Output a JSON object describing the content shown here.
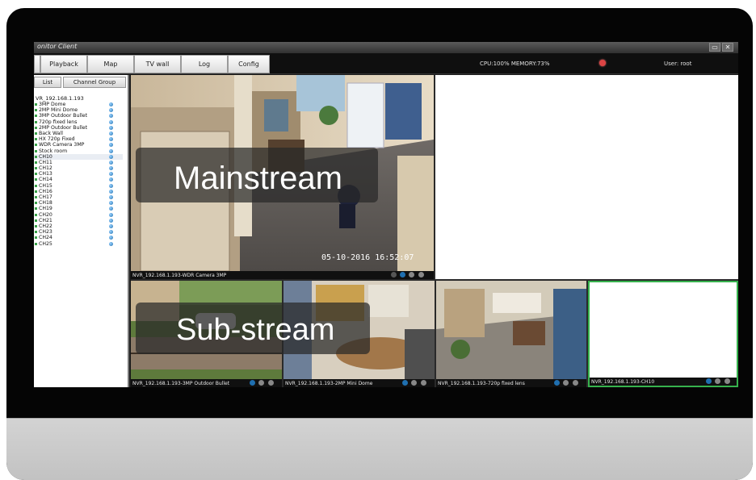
{
  "app": {
    "title": "onitor Client"
  },
  "window_controls": {
    "restore": "▭",
    "close": "✕"
  },
  "toolbar": {
    "tabs": [
      {
        "label": ""
      },
      {
        "label": "Playback"
      },
      {
        "label": "Map"
      },
      {
        "label": "TV wall"
      },
      {
        "label": "Log"
      },
      {
        "label": "Config"
      }
    ],
    "cpu_memory": "CPU:100%  MEMORY:73%",
    "user": "User: root"
  },
  "sidebar": {
    "tabs": [
      "List",
      "Channel Group"
    ],
    "device": "VR_192.168.1.193",
    "channels": [
      "3MP Dome",
      "2MP Mini Dome",
      "3MP Outdoor Bullet",
      "720p fixed lens",
      "2MP Outdoor Bullet",
      "Back Wall",
      "HX 720p Fixed",
      "WDR Camera 3MP",
      "Stock room",
      "CH10",
      "CH11",
      "CH12",
      "CH13",
      "CH14",
      "CH15",
      "CH16",
      "CH17",
      "CH18",
      "CH19",
      "CH20",
      "CH21",
      "CH22",
      "CH23",
      "CH24",
      "CH25"
    ],
    "selected_index": 9
  },
  "grid": {
    "main": {
      "label": "NVR_192.168.1.193-WDR Camera 3MP",
      "overlay": "Mainstream",
      "timestamp": "05-10-2016 16:52:07"
    },
    "sub_overlay": "Sub-stream",
    "cells": [
      {
        "label": "NVR_192.168.1.193-3MP Outdoor Bullet"
      },
      {
        "label": "NVR_192.168.1.193-2MP Mini Dome"
      },
      {
        "label": "NVR_192.168.1.193-720p fixed lens"
      },
      {
        "label": "NVR_192.168.1.193-CH10"
      }
    ]
  },
  "colors": {
    "accent_green": "#37b24d",
    "status_blue": "#1f6fb0"
  }
}
